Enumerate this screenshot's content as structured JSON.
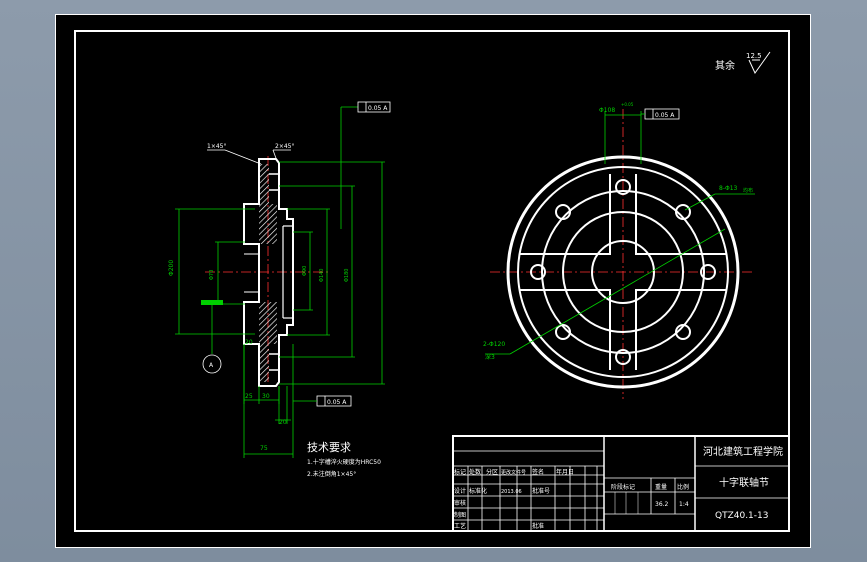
{
  "roughness": {
    "label": "其余",
    "value": "12.5"
  },
  "front_view": {
    "chamfer_left": "1×45°",
    "chamfer_right": "2×45°",
    "dim_phi_outer": "Φ200",
    "dim_phi_mid": "Φ180",
    "dim_phi_bore": "Φ70",
    "dim_phi_inner": "Φ90",
    "dim_phi_hub": "Φ140",
    "dim_25a": "25",
    "dim_30": "30",
    "dim_20a": "20",
    "dim_20b": "20",
    "dim_75": "75",
    "datum": "A",
    "tol_top": "0.05 A",
    "tol_bottom": "0.05 A"
  },
  "side_view": {
    "bolt_circle": "Φ108",
    "bolt_tol": "+0.05",
    "tol_frame": "0.05 A",
    "holes": "8-Φ13",
    "holes_note": "均布",
    "slot": "2-Φ120",
    "slot_note": "深3"
  },
  "tech_req": {
    "title": "技术要求",
    "line1": "1.十字槽淬火硬度为HRC50",
    "line2": "2.未注倒角1×45°"
  },
  "title_block": {
    "school": "河北建筑工程学院",
    "part_name": "十字联轴节",
    "drawing_no": "QTZ40.1-13",
    "h_mark": "标记",
    "h_count": "处数",
    "h_zone": "分区",
    "h_doc": "更改文件号",
    "h_sign": "签名",
    "h_date": "年月日",
    "h_design": "设计",
    "h_std": "标准化",
    "h_date_val": "2013.06",
    "h_approve": "批准号",
    "h_check": "审核",
    "h_draw": "制图",
    "h_process": "工艺",
    "h_approve2": "批准",
    "h_stage": "阶段标记",
    "h_weight": "重量",
    "h_scale": "比例",
    "weight_val": "36.2",
    "scale_val": "1:4"
  }
}
